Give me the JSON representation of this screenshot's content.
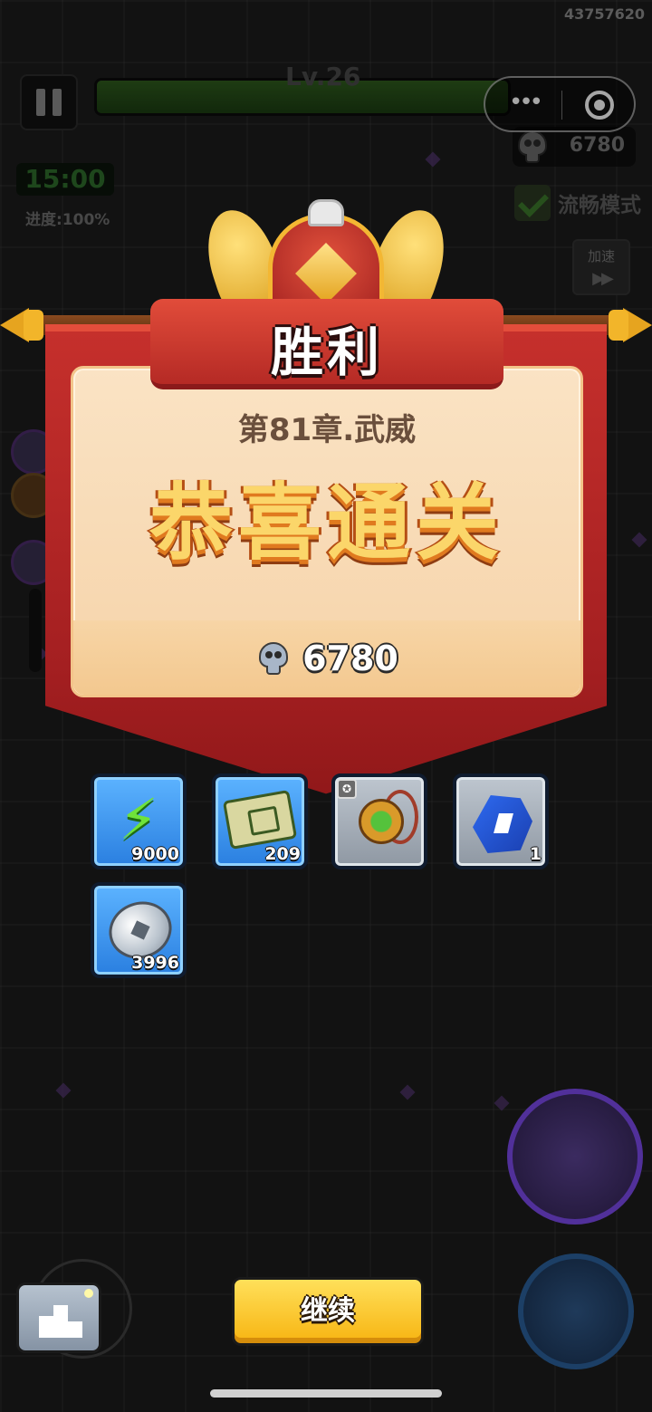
{
  "hud": {
    "account_id": "43757620",
    "level": "Lv.26",
    "timer": "15:00",
    "progress_text": "进度:100%",
    "kill_count": "6780",
    "smooth_mode": "流畅模式",
    "speed_label": "加速",
    "speed_arrows": "▶▶",
    "xp_fraction": 1.0
  },
  "miniprogram": {
    "more_icon": "more-dots-icon",
    "close_icon": "target-ring-icon"
  },
  "victory": {
    "title": "胜利",
    "chapter": "第81章.武威",
    "congrats": "恭喜通关",
    "reward_icon": "skull-icon",
    "reward_value": "6780"
  },
  "items": [
    {
      "name": "energy",
      "icon": "lightning-icon",
      "count": "9000",
      "rarity": "blue"
    },
    {
      "name": "scroll",
      "icon": "scroll-icon",
      "count": "209",
      "rarity": "blue"
    },
    {
      "name": "amulet",
      "icon": "amulet-icon",
      "count": "",
      "rarity": "gray"
    },
    {
      "name": "gem",
      "icon": "blue-gem-icon",
      "count": "1",
      "rarity": "gray"
    },
    {
      "name": "coin",
      "icon": "silver-coin-icon",
      "count": "3996",
      "rarity": "blue"
    }
  ],
  "bottom": {
    "continue_label": "继续",
    "rank_icon": "podium-icon"
  },
  "colors": {
    "banner_red": "#c6302c",
    "panel_cream": "#fae3c4",
    "continue_yellow": "#ffe05a",
    "item_blue": "#2a7fe0",
    "item_gray": "#8f98a3"
  }
}
